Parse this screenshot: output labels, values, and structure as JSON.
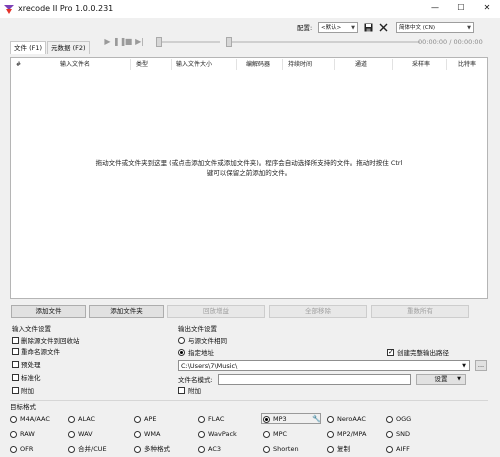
{
  "window": {
    "title": "xrecode II Pro 1.0.0.231",
    "minimize": "—",
    "maximize": "☐",
    "close": "✕"
  },
  "tabs": [
    {
      "label": "文件 (F1)",
      "active": true
    },
    {
      "label": "元数据 (F2)",
      "active": false
    }
  ],
  "player": {
    "time": "00:00:00 / 00:00:00"
  },
  "toolbar": {
    "config_label": "配置:",
    "config_value": "<默认>",
    "language_value": "简体中文 (CN)"
  },
  "columns": [
    "#",
    "输入文件名",
    "类型",
    "输入文件大小",
    "编解码器",
    "持续时间",
    "通道",
    "采样率",
    "比特率"
  ],
  "list_hint": {
    "line1": "拖动文件或文件夹到这里 (或点击添加文件或添加文件夹)。程序会自动选择所支持的文件。拖动时按住 Ctrl",
    "line2": "键可以保留之前添加的文件。"
  },
  "buttons": {
    "add_file": "添加文件",
    "add_folder": "添加文件夹",
    "replay_gain": "回放增益",
    "remove_all": "全部移除",
    "rename_all": "重数所有"
  },
  "input_settings": {
    "title": "输入文件设置",
    "options": [
      {
        "label": "删除源文件到回收站",
        "checked": false
      },
      {
        "label": "重命名源文件",
        "checked": false
      },
      {
        "label": "预处理",
        "checked": false
      },
      {
        "label": "标准化",
        "checked": false
      },
      {
        "label": "附加",
        "checked": false
      }
    ]
  },
  "output_settings": {
    "title": "输出文件设置",
    "same_as_source": "与源文件相同",
    "specified": "指定地址",
    "create_dir": "创建完整输出路径",
    "path": "C:\\Users\\7\\Music\\",
    "browse": "...",
    "filename_pattern_label": "文件名模式:",
    "settings_button": "设置",
    "append": "附加"
  },
  "target_format": {
    "title": "目标格式",
    "selected": "MP3",
    "rows": [
      [
        "M4A/AAC",
        "ALAC",
        "APE",
        "FLAC",
        "MP3",
        "NeroAAC",
        "OGG"
      ],
      [
        "RAW",
        "WAV",
        "WMA",
        "WavPack",
        "MPC",
        "MP2/MPA",
        "SND"
      ],
      [
        "OFR",
        "合并/CUE",
        "多种格式",
        "AC3",
        "Shorten",
        "复制",
        "AIFF"
      ]
    ]
  }
}
